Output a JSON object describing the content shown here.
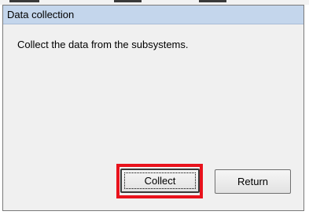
{
  "dialog": {
    "title": "Data collection",
    "message": "Collect the data from the subsystems."
  },
  "buttons": {
    "collect_label": "Collect",
    "return_label": "Return"
  },
  "colors": {
    "titlebar": "#c4d6ec",
    "dialog_bg": "#f0f0f0",
    "highlight": "#e8121c"
  }
}
